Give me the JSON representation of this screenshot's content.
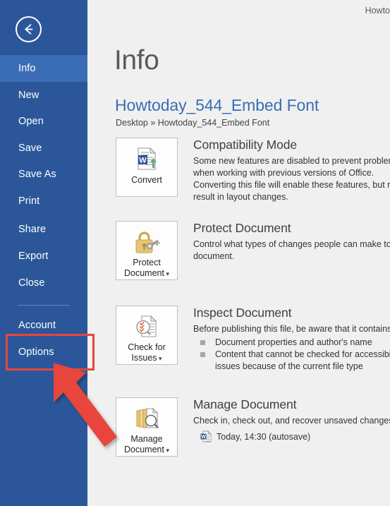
{
  "window": {
    "title_truncated": "Howto"
  },
  "sidebar": {
    "back_icon": "back-arrow-icon",
    "items": [
      {
        "label": "Info",
        "active": true
      },
      {
        "label": "New",
        "active": false
      },
      {
        "label": "Open",
        "active": false
      },
      {
        "label": "Save",
        "active": false
      },
      {
        "label": "Save As",
        "active": false
      },
      {
        "label": "Print",
        "active": false
      },
      {
        "label": "Share",
        "active": false
      },
      {
        "label": "Export",
        "active": false
      },
      {
        "label": "Close",
        "active": false
      },
      {
        "label": "Account",
        "active": false
      },
      {
        "label": "Options",
        "active": false
      }
    ]
  },
  "main": {
    "heading": "Info",
    "document_title": "Howtoday_544_Embed Font",
    "document_path": "Desktop » Howtoday_544_Embed Font",
    "sections": [
      {
        "key": "compatibility",
        "button_label": "Convert",
        "button_icon": "convert-document-icon",
        "has_caret": false,
        "title": "Compatibility Mode",
        "description": "Some new features are disabled to prevent problems when working with previous versions of Office. Converting this file will enable these features, but may result in layout changes."
      },
      {
        "key": "protect",
        "button_label": "Protect\nDocument",
        "button_icon": "padlock-key-icon",
        "has_caret": true,
        "title": "Protect Document",
        "description": "Control what types of changes people can make to this document."
      },
      {
        "key": "inspect",
        "button_label": "Check for\nIssues",
        "button_icon": "inspect-document-icon",
        "has_caret": true,
        "title": "Inspect Document",
        "description": "Before publishing this file, be aware that it contains:",
        "bullets": [
          "Document properties and author's name",
          "Content that cannot be checked for accessibility issues because of the current file type"
        ]
      },
      {
        "key": "manage",
        "button_label": "Manage\nDocument",
        "button_icon": "manage-document-icon",
        "has_caret": true,
        "title": "Manage Document",
        "description": "Check in, check out, and recover unsaved changes.",
        "autosave": {
          "icon": "word-document-icon",
          "label": "Today, 14:30 (autosave)"
        }
      }
    ]
  },
  "annotation": {
    "highlight_target": "Options",
    "box_color": "#E8453C",
    "arrow_color": "#E8453C"
  },
  "colors": {
    "sidebar_bg": "#2B579A",
    "sidebar_active": "#3A6DB5",
    "main_bg": "#F0F0F0",
    "accent_link": "#3A6DB5",
    "annotation_red": "#E8453C"
  }
}
